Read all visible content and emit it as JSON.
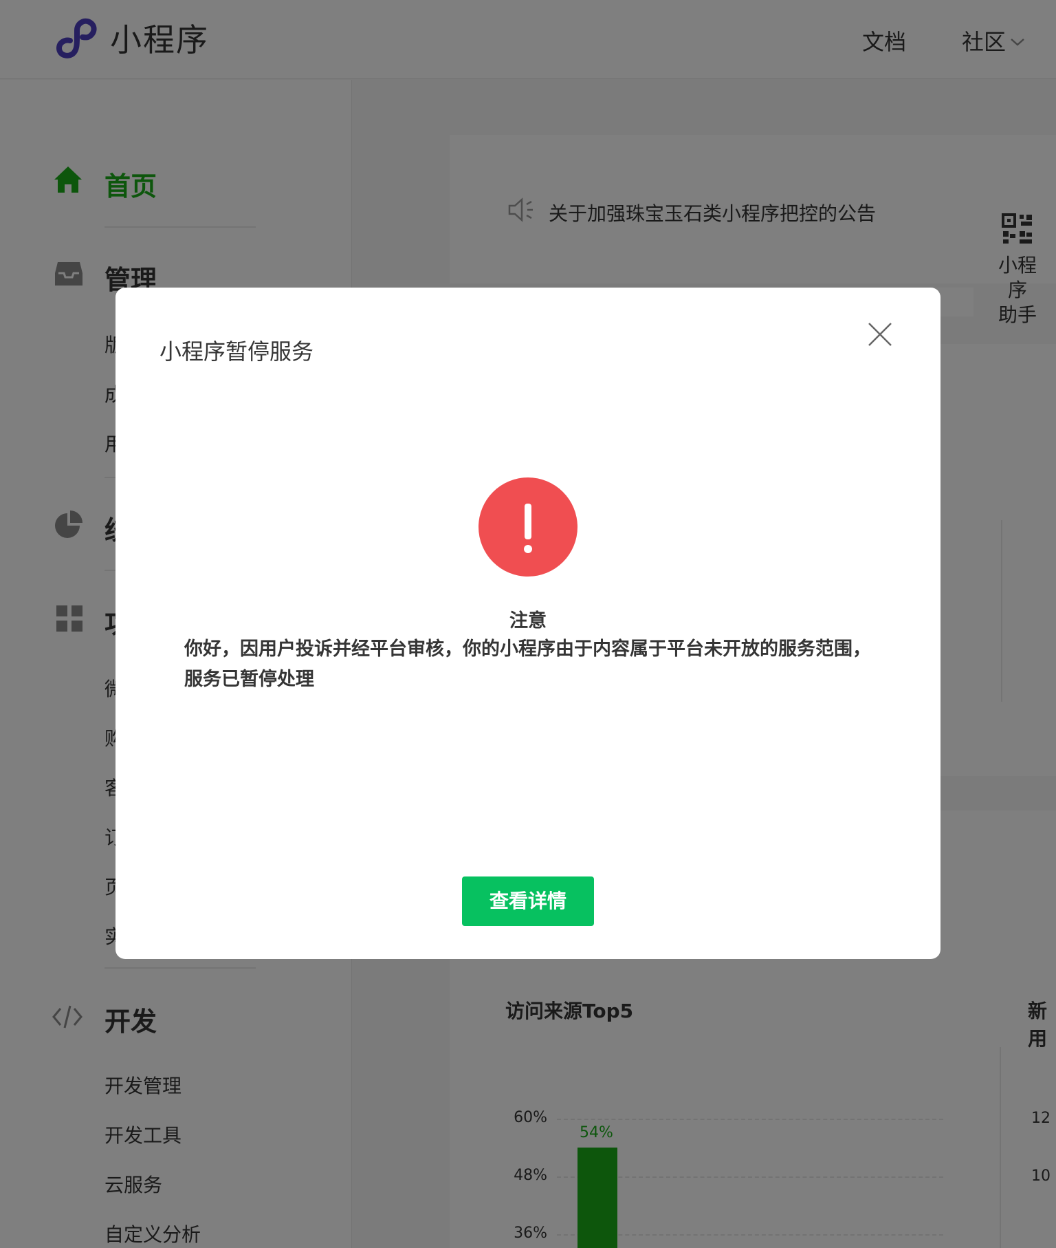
{
  "header": {
    "logo_text": "小程序",
    "nav_docs": "文档",
    "nav_community": "社区"
  },
  "sidebar": {
    "home": "首页",
    "manage": "管理",
    "manage_items": [
      "版",
      "成",
      "用"
    ],
    "stats": "统",
    "features": "功",
    "feature_items": [
      "微",
      "购",
      "客",
      "订",
      "页",
      "实"
    ],
    "develop": "开发",
    "develop_items": [
      "开发管理",
      "开发工具",
      "云服务",
      "自定义分析"
    ]
  },
  "main": {
    "notice": "关于加强珠宝玉石类小程序把控的公告",
    "assistant_label_1": "小程",
    "assistant_label_2": "序",
    "assistant_label_3": "助手",
    "chart_title": "访问来源Top5",
    "chart_title_2": "新用",
    "right_ticks": [
      "12",
      "10"
    ]
  },
  "chart_data": {
    "type": "bar",
    "title": "访问来源Top5",
    "yticks": [
      "60%",
      "48%",
      "36%"
    ],
    "bars": [
      {
        "value": 54,
        "label": "54%"
      }
    ],
    "ylim": [
      36,
      60
    ]
  },
  "modal": {
    "title": "小程序暂停服务",
    "warn_title": "注意",
    "warn_body": "你好，因用户投诉并经平台审核，你的小程序由于内容属于平台未开放的服务范围，服务已暂停处理",
    "button": "查看详情"
  },
  "colors": {
    "brand_green": "#07c160",
    "warn_red": "#f04e51",
    "logo_purple": "#4d3fbf"
  }
}
